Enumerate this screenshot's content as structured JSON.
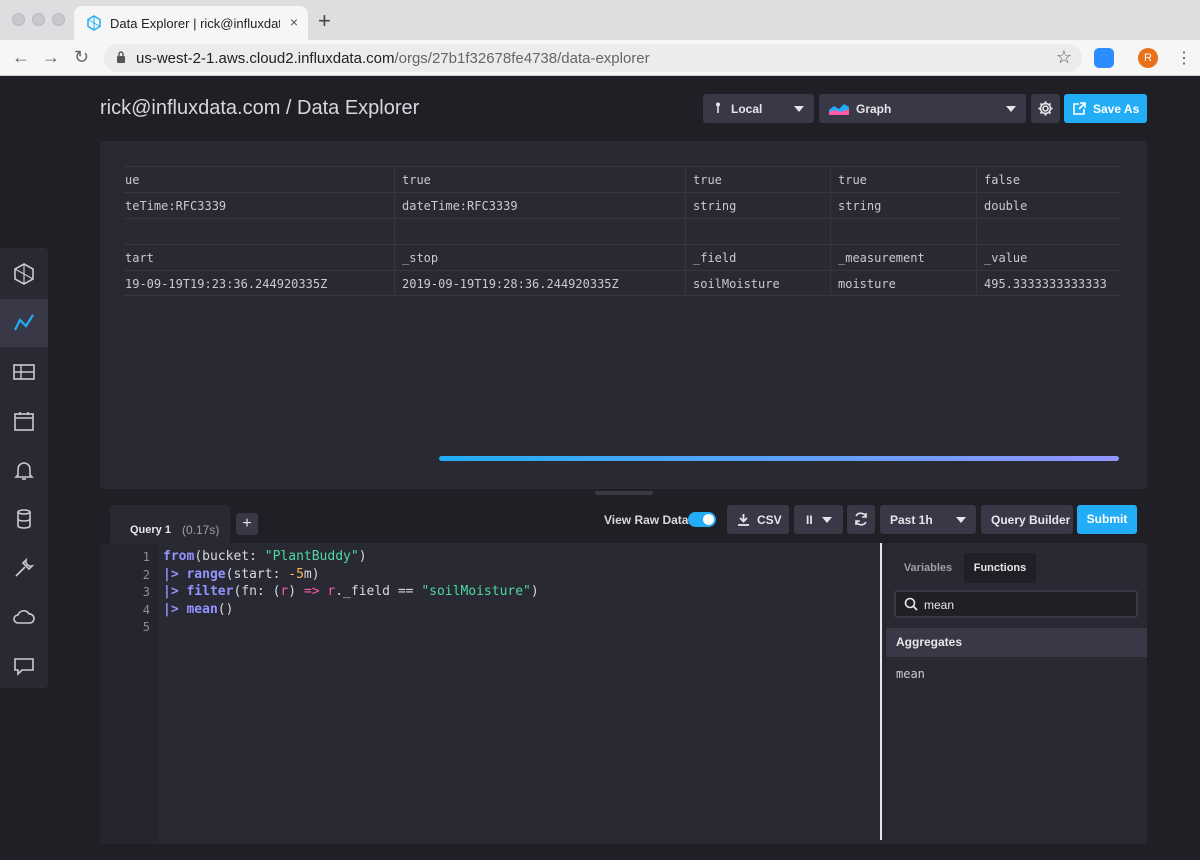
{
  "browser": {
    "tab_title": "Data Explorer | rick@influxdata.com",
    "tab_close": "×",
    "new_tab": "+",
    "url_host": "us-west-2-1.aws.cloud2.influxdata.com",
    "url_path": "/orgs/27b1f32678fe4738/data-explorer",
    "avatar_letter": "R",
    "back_icon": "←",
    "forward_icon": "→",
    "reload_icon": "↻",
    "star_icon": "☆",
    "menu_icon": "⋮"
  },
  "header": {
    "title": "rick@influxdata.com / Data Explorer",
    "timezone_label": "Local",
    "view_label": "Graph",
    "save_label": "Save As"
  },
  "results": {
    "rows": [
      [
        "ue",
        "true",
        "true",
        "true",
        "false"
      ],
      [
        "teTime:RFC3339",
        "dateTime:RFC3339",
        "string",
        "string",
        "double"
      ],
      [
        "",
        "",
        "",
        "",
        ""
      ],
      [
        "tart",
        "_stop",
        "_field",
        "_measurement",
        "_value"
      ],
      [
        "19-09-19T19:23:36.244920335Z",
        "2019-09-19T19:28:36.244920335Z",
        "soilMoisture",
        "moisture",
        "495.3333333333333"
      ]
    ]
  },
  "query": {
    "tab_name": "Query 1",
    "tab_time": "(0.17s)",
    "add_label": "+",
    "raw_data_label": "View Raw Data",
    "raw_data_on": true,
    "csv_label": "CSV",
    "pause_label": "II",
    "range_label": "Past 1h",
    "builder_label": "Query Builder",
    "submit_label": "Submit",
    "line_numbers": [
      "1",
      "2",
      "3",
      "4",
      "5"
    ],
    "code": {
      "l1_fn": "from",
      "l1_open": "(bucket: ",
      "l1_str": "\"PlantBuddy\"",
      "l1_close": ")",
      "l2_pipe": "|>",
      "l2_fn": "range",
      "l2_open": "(start: ",
      "l2_num": "-5",
      "l2_unit": "m)",
      "l3_pipe": "|>",
      "l3_fn": "filter",
      "l3_open": "(fn: (",
      "l3_r": "r",
      "l3_mid": ") ",
      "l3_arrow": "=>",
      "l3_space": " ",
      "l3_rfield": "r",
      "l3_field": "._field == ",
      "l3_str": "\"soilMoisture\"",
      "l3_close": ")",
      "l4_pipe": "|>",
      "l4_fn": "mean",
      "l4_close": "()"
    }
  },
  "functions": {
    "tab_variables": "Variables",
    "tab_functions": "Functions",
    "search_value": "mean",
    "group_header": "Aggregates",
    "items": [
      "mean"
    ]
  },
  "colors": {
    "accent": "#22adf6",
    "background": "#1f1f25",
    "panel": "#292933"
  }
}
